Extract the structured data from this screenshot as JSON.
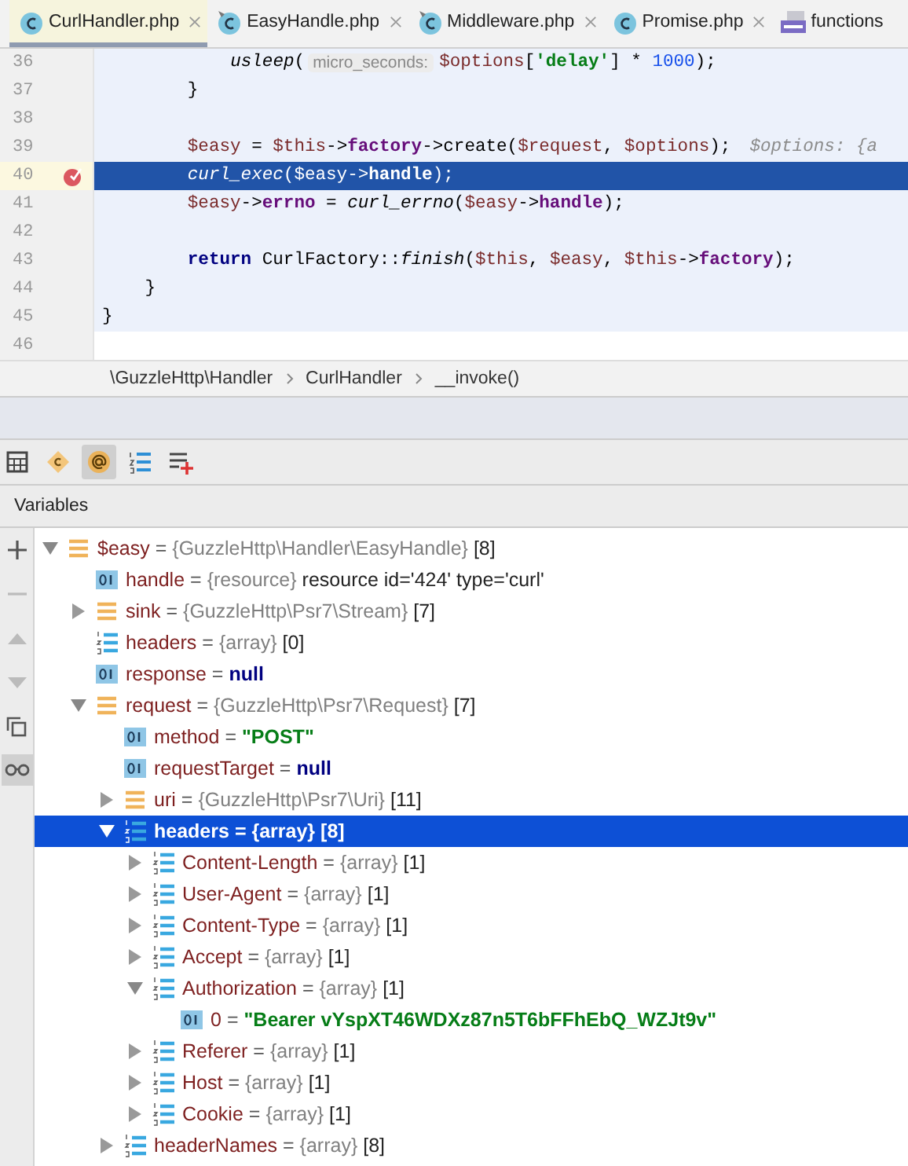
{
  "tabs": [
    {
      "label": "CurlHandler.php",
      "kind": "class",
      "selected": true
    },
    {
      "label": "EasyHandle.php",
      "kind": "class-pinned",
      "selected": false
    },
    {
      "label": "Middleware.php",
      "kind": "class-pinned",
      "selected": false
    },
    {
      "label": "Promise.php",
      "kind": "class",
      "selected": false
    },
    {
      "label": "functions",
      "kind": "php",
      "selected": false
    }
  ],
  "code": [
    {
      "number": "36",
      "kind": "nested",
      "scope": true,
      "current": false,
      "breakpoint": false,
      "tokens": [
        {
          "text": "usleep",
          "kind": "fn"
        },
        {
          "text": "(",
          "kind": "plain"
        },
        {
          "text": "micro_seconds:",
          "kind": "hint"
        },
        {
          "text": "$options",
          "kind": "var"
        },
        {
          "text": "[",
          "kind": "plain"
        },
        {
          "text": "'delay'",
          "kind": "string"
        },
        {
          "text": "] * ",
          "kind": "plain"
        },
        {
          "text": "1000",
          "kind": "number"
        },
        {
          "text": ");",
          "kind": "plain"
        }
      ]
    },
    {
      "number": "37",
      "kind": "body",
      "scope": true,
      "current": false,
      "breakpoint": false,
      "tokens": [
        {
          "text": "}",
          "kind": "plain"
        }
      ]
    },
    {
      "number": "38",
      "kind": "body",
      "scope": true,
      "current": false,
      "breakpoint": false
    },
    {
      "number": "39",
      "kind": "body",
      "scope": true,
      "current": false,
      "breakpoint": false,
      "tokens": [
        {
          "text": "$easy",
          "kind": "var"
        },
        {
          "text": " = ",
          "kind": "plain"
        },
        {
          "text": "$this",
          "kind": "var"
        },
        {
          "text": "->",
          "kind": "plain"
        },
        {
          "text": "factory",
          "kind": "field"
        },
        {
          "text": "->create(",
          "kind": "plain"
        },
        {
          "text": "$request",
          "kind": "var"
        },
        {
          "text": ", ",
          "kind": "plain"
        },
        {
          "text": "$options",
          "kind": "var"
        },
        {
          "text": ");",
          "kind": "plain"
        },
        {
          "text": "$options: {a",
          "kind": "inlay"
        }
      ]
    },
    {
      "number": "40",
      "kind": "body",
      "current": true,
      "breakpoint": true,
      "tokens": [
        {
          "text": "curl_exec",
          "kind": "fn"
        },
        {
          "text": "(",
          "kind": "plain"
        },
        {
          "text": "$easy",
          "kind": "var"
        },
        {
          "text": "->",
          "kind": "plain"
        },
        {
          "text": "handle",
          "kind": "field"
        },
        {
          "text": ");",
          "kind": "plain"
        }
      ]
    },
    {
      "number": "41",
      "kind": "body",
      "scope": true,
      "current": false,
      "breakpoint": false,
      "tokens": [
        {
          "text": "$easy",
          "kind": "var"
        },
        {
          "text": "->",
          "kind": "plain"
        },
        {
          "text": "errno",
          "kind": "field"
        },
        {
          "text": " = ",
          "kind": "plain"
        },
        {
          "text": "curl_errno",
          "kind": "fn"
        },
        {
          "text": "(",
          "kind": "plain"
        },
        {
          "text": "$easy",
          "kind": "var"
        },
        {
          "text": "->",
          "kind": "plain"
        },
        {
          "text": "handle",
          "kind": "field"
        },
        {
          "text": ");",
          "kind": "plain"
        }
      ]
    },
    {
      "number": "42",
      "kind": "body",
      "scope": true,
      "current": false,
      "breakpoint": false
    },
    {
      "number": "43",
      "kind": "body",
      "scope": true,
      "current": false,
      "breakpoint": false,
      "tokens": [
        {
          "text": "return",
          "kind": "kw"
        },
        {
          "text": " CurlFactory::",
          "kind": "plain"
        },
        {
          "text": "finish",
          "kind": "fn"
        },
        {
          "text": "(",
          "kind": "plain"
        },
        {
          "text": "$this",
          "kind": "var"
        },
        {
          "text": ", ",
          "kind": "plain"
        },
        {
          "text": "$easy",
          "kind": "var"
        },
        {
          "text": ", ",
          "kind": "plain"
        },
        {
          "text": "$this",
          "kind": "var"
        },
        {
          "text": "->",
          "kind": "plain"
        },
        {
          "text": "factory",
          "kind": "field"
        },
        {
          "text": ");",
          "kind": "plain"
        }
      ]
    },
    {
      "number": "44",
      "kind": "method-end",
      "scope": true,
      "current": false,
      "breakpoint": false,
      "tokens": [
        {
          "text": "}",
          "kind": "plain"
        }
      ]
    },
    {
      "number": "45",
      "kind": "class-end",
      "scope": true,
      "current": false,
      "breakpoint": false,
      "tokens": [
        {
          "text": "}",
          "kind": "plain"
        }
      ]
    },
    {
      "number": "46",
      "kind": "class-end",
      "current": false,
      "breakpoint": false
    }
  ],
  "breadcrumbs": [
    "\\GuzzleHttp\\Handler",
    "CurlHandler",
    "__invoke()"
  ],
  "toolbar": [
    {
      "kind": "calculator",
      "selected": false
    },
    {
      "kind": "class",
      "selected": false
    },
    {
      "kind": "at",
      "selected": true
    },
    {
      "kind": "numbered-list",
      "selected": false
    },
    {
      "kind": "list-add",
      "selected": false
    }
  ],
  "panel_title": "Variables",
  "variables": [
    {
      "name": "$easy",
      "kind": "object",
      "operator": "=",
      "type": "{GuzzleHttp\\Handler\\EasyHandle}",
      "value": {
        "text": "[8]",
        "kind": "count"
      },
      "selected": false,
      "expanded": true,
      "children": [
        {
          "name": "handle",
          "kind": "primitive",
          "operator": "=",
          "type": "{resource}",
          "value": {
            "text": "resource id='424' type='curl'",
            "kind": "count"
          },
          "selected": false
        },
        {
          "name": "sink",
          "kind": "object",
          "operator": "=",
          "type": "{GuzzleHttp\\Psr7\\Stream}",
          "value": {
            "text": "[7]",
            "kind": "count"
          },
          "selected": false,
          "expanded": false
        },
        {
          "name": "headers",
          "kind": "array",
          "operator": "=",
          "type": "{array}",
          "value": {
            "text": "[0]",
            "kind": "count"
          },
          "selected": false
        },
        {
          "name": "response",
          "kind": "primitive",
          "operator": "=",
          "value": {
            "text": "null",
            "kind": "null"
          },
          "selected": false
        },
        {
          "name": "request",
          "kind": "object",
          "operator": "=",
          "type": "{GuzzleHttp\\Psr7\\Request}",
          "value": {
            "text": "[7]",
            "kind": "count"
          },
          "selected": false,
          "expanded": true,
          "children": [
            {
              "name": "method",
              "kind": "primitive",
              "operator": "=",
              "value": {
                "text": "\"POST\"",
                "kind": "string"
              },
              "selected": false
            },
            {
              "name": "requestTarget",
              "kind": "primitive",
              "operator": "=",
              "value": {
                "text": "null",
                "kind": "null"
              },
              "selected": false
            },
            {
              "name": "uri",
              "kind": "object",
              "operator": "=",
              "type": "{GuzzleHttp\\Psr7\\Uri}",
              "value": {
                "text": "[11]",
                "kind": "count"
              },
              "selected": false,
              "expanded": false
            },
            {
              "name": "headers",
              "kind": "array",
              "operator": "=",
              "type": "{array}",
              "value": {
                "text": "[8]",
                "kind": "count"
              },
              "selected": true,
              "expanded": true,
              "children": [
                {
                  "name": "Content-Length",
                  "kind": "array",
                  "operator": "=",
                  "type": "{array}",
                  "value": {
                    "text": "[1]",
                    "kind": "count"
                  },
                  "selected": false,
                  "expanded": false
                },
                {
                  "name": "User-Agent",
                  "kind": "array",
                  "operator": "=",
                  "type": "{array}",
                  "value": {
                    "text": "[1]",
                    "kind": "count"
                  },
                  "selected": false,
                  "expanded": false
                },
                {
                  "name": "Content-Type",
                  "kind": "array",
                  "operator": "=",
                  "type": "{array}",
                  "value": {
                    "text": "[1]",
                    "kind": "count"
                  },
                  "selected": false,
                  "expanded": false
                },
                {
                  "name": "Accept",
                  "kind": "array",
                  "operator": "=",
                  "type": "{array}",
                  "value": {
                    "text": "[1]",
                    "kind": "count"
                  },
                  "selected": false,
                  "expanded": false
                },
                {
                  "name": "Authorization",
                  "kind": "array",
                  "operator": "=",
                  "type": "{array}",
                  "value": {
                    "text": "[1]",
                    "kind": "count"
                  },
                  "selected": false,
                  "expanded": true,
                  "children": [
                    {
                      "name": "0",
                      "kind": "primitive",
                      "operator": "=",
                      "value": {
                        "text": "\"Bearer vYspXT46WDXz87n5T6bFFhEbQ_WZJt9v\"",
                        "kind": "string"
                      },
                      "selected": false
                    }
                  ]
                },
                {
                  "name": "Referer",
                  "kind": "array",
                  "operator": "=",
                  "type": "{array}",
                  "value": {
                    "text": "[1]",
                    "kind": "count"
                  },
                  "selected": false,
                  "expanded": false
                },
                {
                  "name": "Host",
                  "kind": "array",
                  "operator": "=",
                  "type": "{array}",
                  "value": {
                    "text": "[1]",
                    "kind": "count"
                  },
                  "selected": false,
                  "expanded": false
                },
                {
                  "name": "Cookie",
                  "kind": "array",
                  "operator": "=",
                  "type": "{array}",
                  "value": {
                    "text": "[1]",
                    "kind": "count"
                  },
                  "selected": false,
                  "expanded": false
                }
              ]
            },
            {
              "name": "headerNames",
              "kind": "array",
              "operator": "=",
              "type": "{array}",
              "value": {
                "text": "[8]",
                "kind": "count"
              },
              "selected": false,
              "expanded": false
            }
          ]
        }
      ]
    }
  ]
}
